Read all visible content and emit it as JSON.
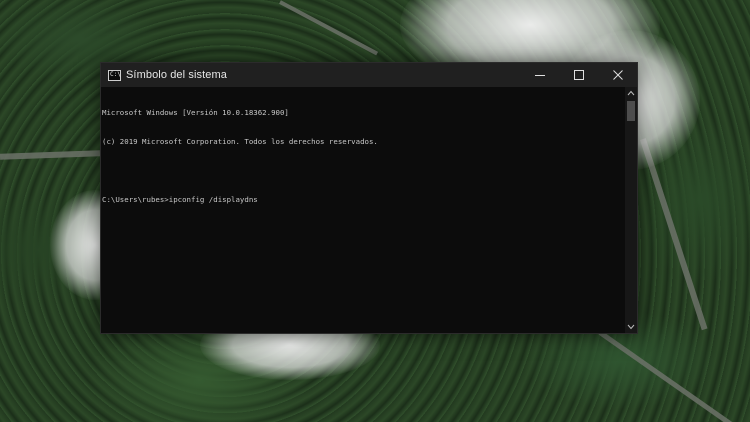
{
  "window": {
    "title": "Símbolo del sistema",
    "icon": "cmd-icon",
    "icon_text": "C:\\",
    "controls": [
      "minimize-icon",
      "maximize-icon",
      "close-icon"
    ]
  },
  "console": {
    "lines": [
      "Microsoft Windows [Versión 10.0.18362.900]",
      "(c) 2019 Microsoft Corporation. Todos los derechos reservados.",
      "",
      "C:\\Users\\rubes>ipconfig /displaydns"
    ]
  },
  "colors": {
    "console_bg": "#0c0c0c",
    "console_text": "#c8c8c8",
    "titlebar_bg": "#202020"
  }
}
